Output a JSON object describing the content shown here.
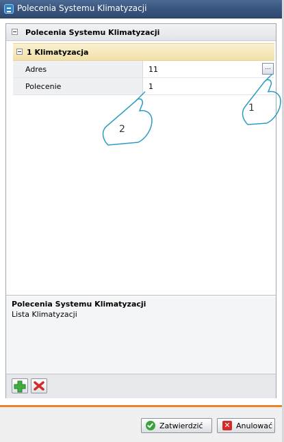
{
  "window": {
    "title": "Polecenia Systemu Klimatyzacji"
  },
  "grid": {
    "header": "Polecenia Systemu Klimatyzacji",
    "category": "1 Klimatyzacja",
    "rows": [
      {
        "name": "Adres",
        "value": "11",
        "button": "..."
      },
      {
        "name": "Polecenie",
        "value": "1"
      }
    ]
  },
  "description": {
    "title": "Polecenia Systemu Klimatyzacji",
    "text": "Lista Klimatyzacji"
  },
  "callouts": [
    "1",
    "2"
  ],
  "footer": {
    "ok_label": "Zatwierdzić",
    "cancel_label": "Anulować"
  },
  "colors": {
    "titlebar": "#3b577f",
    "accent_line": "#e8832a",
    "category_bg": "#f0e0a8"
  },
  "icons": [
    "app-icon",
    "add-icon",
    "delete-icon",
    "confirm-icon",
    "cancel-icon"
  ]
}
